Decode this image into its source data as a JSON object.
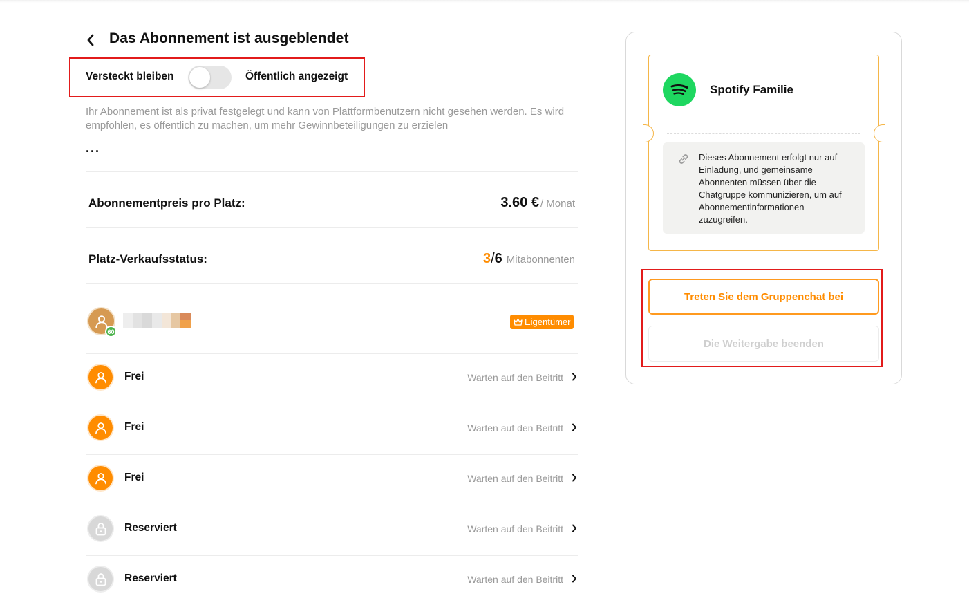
{
  "header": {
    "title": "Das Abonnement ist ausgeblendet",
    "back_icon": "chevron-left-icon"
  },
  "visibility": {
    "left_label": "Versteckt bleiben",
    "right_label": "Öffentlich angezeigt",
    "is_public": false,
    "description": "Ihr Abonnement ist als privat festgelegt und kann von Plattformbenutzern nicht gesehen werden. Es wird empfohlen, es öffentlich zu machen, um mehr Gewinnbeteiligungen zu erzielen",
    "more": "..."
  },
  "price": {
    "label": "Abonnementpreis pro Platz:",
    "value": "3.60 €",
    "unit": "/ Monat"
  },
  "sales_status": {
    "label": "Platz-Verkaufsstatus:",
    "sold": "3",
    "separator": "/",
    "total": "6",
    "unit": "Mitabonnenten"
  },
  "owner": {
    "level": "60",
    "badge": "Eigentümer",
    "badge_icon": "crown-icon",
    "avatar_icon": "user-icon"
  },
  "slots": [
    {
      "label": "Frei",
      "status": "Warten auf den Beitritt",
      "type": "free",
      "icon": "user-icon"
    },
    {
      "label": "Frei",
      "status": "Warten auf den Beitritt",
      "type": "free",
      "icon": "user-icon"
    },
    {
      "label": "Frei",
      "status": "Warten auf den Beitritt",
      "type": "free",
      "icon": "user-icon"
    },
    {
      "label": "Reserviert",
      "status": "Warten auf den Beitritt",
      "type": "reserved",
      "icon": "lock-icon"
    },
    {
      "label": "Reserviert",
      "status": "Warten auf den Beitritt",
      "type": "reserved",
      "icon": "lock-icon"
    }
  ],
  "card": {
    "service_name": "Spotify Familie",
    "service_icon": "spotify-icon",
    "info_icon": "link-icon",
    "info_text": "Dieses Abonnement erfolgt nur auf Einladung, und gemeinsame Abonnenten müssen über die Chatgruppe kommunizieren, um auf Abonnementinformationen zuzugreifen.",
    "join_button": "Treten Sie dem Gruppenchat bei",
    "stop_button": "Die Weitergabe beenden"
  },
  "colors": {
    "accent": "#ff8c00",
    "highlight_border": "#e21b1b",
    "spotify_green": "#1ed760",
    "ticket_border": "#f5b649",
    "muted_text": "#999999"
  }
}
